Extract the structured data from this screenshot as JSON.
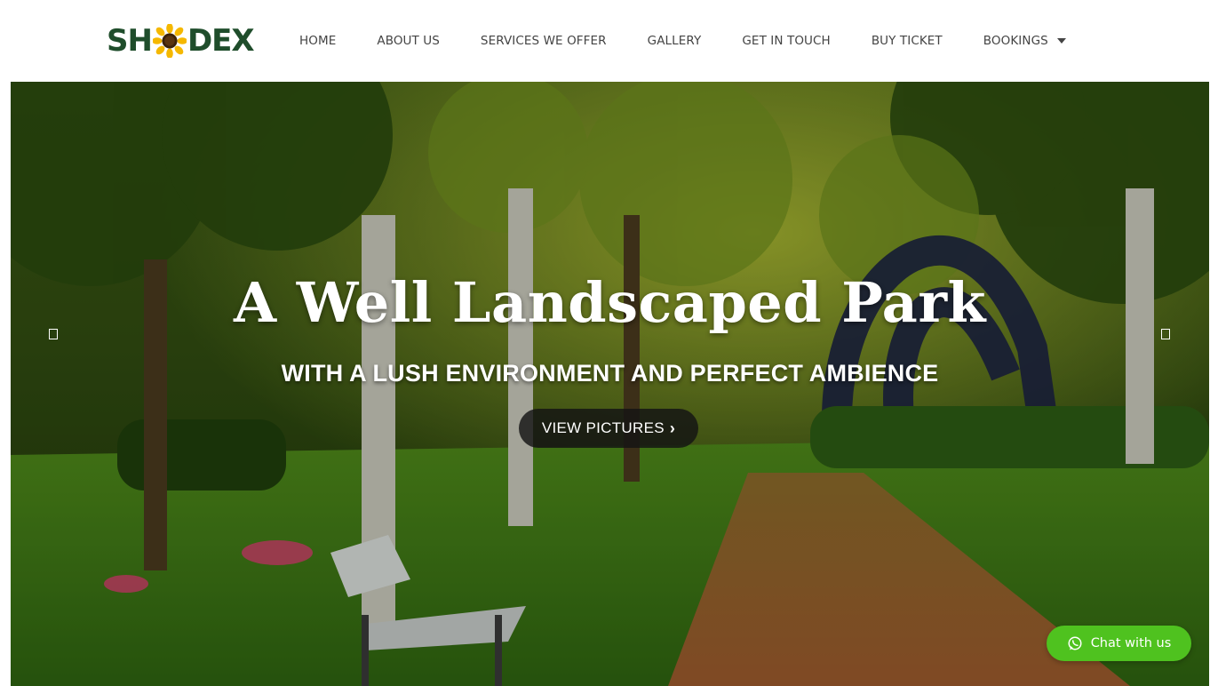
{
  "header": {
    "logo": {
      "part1": "SH",
      "part2": "DEX",
      "icon": "sunflower-icon"
    },
    "nav": [
      {
        "label": "HOME"
      },
      {
        "label": "ABOUT US"
      },
      {
        "label": "SERVICES WE OFFER"
      },
      {
        "label": "GALLERY"
      },
      {
        "label": "GET IN TOUCH"
      },
      {
        "label": "BUY TICKET"
      },
      {
        "label": "BOOKINGS",
        "icon": "caret-down-icon"
      }
    ]
  },
  "hero": {
    "title": "A Well Landscaped Park",
    "subtitle": "WITH A LUSH ENVIRONMENT AND PERFECT AMBIENCE",
    "button_label": "VIEW PICTURES",
    "button_icon": "chevron-right-icon",
    "prev_icon": "prev-slide-icon",
    "next_icon": "next-slide-icon"
  },
  "chat": {
    "label": "Chat with us",
    "icon": "whatsapp-icon",
    "color": "#4fc21f"
  },
  "colors": {
    "logo": "#1f4d2b",
    "nav_text": "#444444",
    "button_bg": "#141414"
  }
}
